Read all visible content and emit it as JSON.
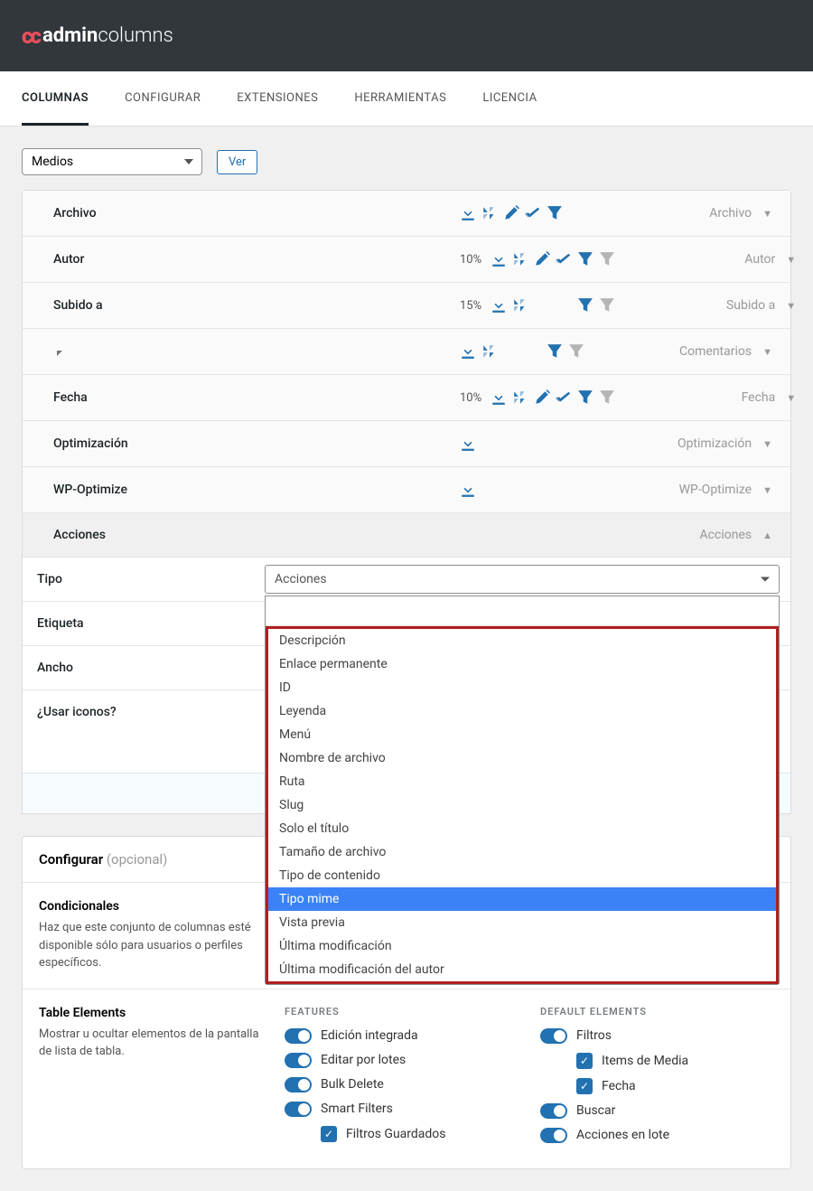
{
  "logo": {
    "brand": "admin",
    "suffix": "columns"
  },
  "tabs": [
    "COLUMNAS",
    "CONFIGURAR",
    "EXTENSIONES",
    "HERRAMIENTAS",
    "LICENCIA"
  ],
  "listType": "Medios",
  "viewBtn": "Ver",
  "columns": [
    {
      "name": "Archivo",
      "pct": "",
      "right": "Archivo",
      "icons": [
        "download",
        "sort",
        "edit",
        "bulk",
        "filter"
      ],
      "expanded": false
    },
    {
      "name": "Autor",
      "pct": "10%",
      "right": "Autor",
      "icons": [
        "download",
        "sort",
        "edit",
        "bulk",
        "filter",
        "funnel-gray"
      ],
      "expanded": false
    },
    {
      "name": "Subido a",
      "pct": "15%",
      "right": "Subido a",
      "icons": [
        "download",
        "sort",
        "spacer",
        "spacer",
        "filter",
        "funnel-gray"
      ],
      "expanded": false
    },
    {
      "name": "__comment__",
      "pct": "",
      "right": "Comentarios",
      "icons": [
        "download",
        "sort",
        "spacer",
        "spacer",
        "filter",
        "funnel-gray"
      ],
      "expanded": false
    },
    {
      "name": "Fecha",
      "pct": "10%",
      "right": "Fecha",
      "icons": [
        "download",
        "sort",
        "edit",
        "bulk",
        "filter",
        "funnel-gray"
      ],
      "expanded": false
    },
    {
      "name": "Optimización",
      "pct": "",
      "right": "Optimización",
      "icons": [
        "download"
      ],
      "expanded": false
    },
    {
      "name": "WP-Optimize",
      "pct": "",
      "right": "WP-Optimize",
      "icons": [
        "download"
      ],
      "expanded": false
    },
    {
      "name": "Acciones",
      "pct": "",
      "right": "Acciones",
      "icons": [],
      "expanded": true
    }
  ],
  "settings": {
    "tipo": {
      "label": "Tipo",
      "value": "Acciones"
    },
    "etiqueta": "Etiqueta",
    "ancho": "Ancho",
    "iconos": "¿Usar iconos?"
  },
  "dropdown": {
    "options": [
      "Descripción",
      "Enlace permanente",
      "ID",
      "Leyenda",
      "Menú",
      "Nombre de archivo",
      "Ruta",
      "Slug",
      "Solo el título",
      "Tamaño de archivo",
      "Tipo de contenido",
      "Tipo mime",
      "Vista previa",
      "Última modificación",
      "Última modificación del autor"
    ],
    "selected": "Tipo mime"
  },
  "config": {
    "title": "Configurar",
    "optional": "(opcional)",
    "cond_title": "Condicionales",
    "cond_desc": "Haz que este conjunto de columnas esté disponible sólo para usuarios o perfiles específicos."
  },
  "tableElements": {
    "title": "Table Elements",
    "desc": "Mostrar u ocultar elementos de la pantalla de lista de tabla.",
    "featuresLabel": "FEATURES",
    "features": [
      "Edición integrada",
      "Editar por lotes",
      "Bulk Delete",
      "Smart Filters"
    ],
    "featureSub": "Filtros Guardados",
    "defaultsLabel": "DEFAULT ELEMENTS",
    "defaults_toggle": "Filtros",
    "defaults_checks": [
      "Items de Media",
      "Fecha"
    ],
    "defaults_toggles2": [
      "Buscar",
      "Acciones en lote"
    ]
  }
}
